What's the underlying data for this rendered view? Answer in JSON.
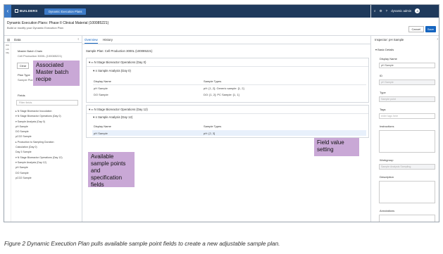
{
  "topbar": {
    "back": "‹",
    "app_name": "BUILDERS",
    "active_tab": "Dynamic Execution Plans",
    "user": "dynamic admin",
    "avatar": "A",
    "icons": [
      "search-icon",
      "gear-icon",
      "help-icon",
      "user-icon"
    ]
  },
  "header": {
    "title": "Dynamic Execution Plans: Phase II Clinical Material (100085221)",
    "subtitle": "Build or modify your Dynamic Execution Plan",
    "cancel": "Cancel",
    "save": "Save"
  },
  "left": {
    "title": "Data",
    "rail": [
      "Ass",
      "Lib",
      "Obj"
    ],
    "master_label": "Master Batch Chain",
    "master_value": "Cell Production 3000L (100085221)",
    "clear": "Clear",
    "plan_type_label": "Plan Type",
    "plan_type_value": "Sample Plan",
    "fields_label": "Fields",
    "filter_placeholder": "Filter fields",
    "tree": [
      "▸ N Stage Bioreactor Inoculation",
      "▾ N Stage Bioreactor Operations (Day 0)",
      "   ▾ Sample Analysis (Day 0)",
      "        pH Sample",
      "        DO Sample",
      "        pCO2 Sample",
      "   ▸ Production to Sampling Duration",
      "      Calculation (Day 0)",
      "        Day 3 Sample",
      "▾ N Stage Bioreactor Operations (Day 12)",
      "   ▾ Sample Analysis (Day 12)",
      "        pH Sample",
      "        DO Sample",
      "        pCO2 Sample"
    ]
  },
  "main": {
    "tab_overview": "Overview",
    "tab_history": "History",
    "sample_plan": "Sample Plan: Cell Production 3000L (100085221)",
    "section1": {
      "title": "N Stage Bioreactor Operations (Day 0)",
      "sub": "Sample Analysis (Day 0)",
      "col1": "Display Name",
      "col2": "Sample Types",
      "rows": [
        {
          "name": "pH Sample",
          "types": "pH: [1, 2]; Generic sample: [1, 2]"
        },
        {
          "name": "DO Sample",
          "types": "DO: [1, 2]; PC Sample: [1, 1]"
        }
      ]
    },
    "section2": {
      "title": "N Stage Bioreactor Operations (Day 12)",
      "sub": "Sample Analysis (Day 12)",
      "col1": "Display Name",
      "col2": "Sample Types",
      "rows": [
        {
          "name": "pH Sample",
          "types": "pH: [2, 3]"
        }
      ]
    }
  },
  "inspector": {
    "title": "Inspector: pH Sample",
    "section": "Basic Details",
    "display_name_label": "Display Name",
    "display_name_value": "pH Sample",
    "id_label": "ID",
    "id_value": "pH Sample",
    "type_label": "Type",
    "type_value": "Sample point",
    "tags_label": "Tags",
    "tags_placeholder": "enter tags here",
    "instructions_label": "Instructions",
    "workgroup_label": "Workgroup",
    "workgroup_value": "Sample Analysis Sampling",
    "description_label": "Description",
    "annotations_label": "Annotations"
  },
  "callouts": {
    "master": "Associated Master batch recipe",
    "available": "Available sample points and specification fields",
    "field": "Field value setting"
  },
  "caption": "Figure 2 Dynamic Execution Plan pulls available sample point fields to create a new adjustable sample plan.",
  "colors": {
    "topbar": "#1f3a5c",
    "accent": "#3d7bc8",
    "primary": "#1565c0",
    "callout": "#c9a8d6"
  }
}
